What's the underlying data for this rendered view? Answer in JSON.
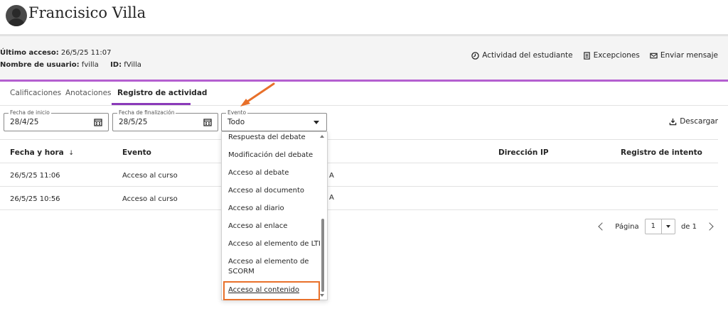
{
  "user": {
    "name": "Francisico Villa"
  },
  "info": {
    "last_access_label": "Último acceso:",
    "last_access_value": "26/5/25 11:07",
    "username_label": "Nombre de usuario:",
    "username_value": "fvilla",
    "id_label": "ID:",
    "id_value": "fVilla"
  },
  "actions": {
    "student_activity": "Actividad del estudiante",
    "exceptions": "Excepciones",
    "send_message": "Enviar mensaje"
  },
  "tabs": [
    {
      "label": "Calificaciones"
    },
    {
      "label": "Anotaciones"
    },
    {
      "label": "Registro de actividad"
    }
  ],
  "filters": {
    "start_date": {
      "label": "Fecha de inicio",
      "value": "28/4/25"
    },
    "end_date": {
      "label": "Fecha de finalización",
      "value": "28/5/25"
    },
    "event": {
      "label": "Evento",
      "value": "Todo"
    },
    "download": "Descargar"
  },
  "table": {
    "headers": [
      "Fecha y hora",
      "Evento",
      "Dirección IP",
      "Registro de intento"
    ],
    "sort_indicator": "↓",
    "rows": [
      {
        "datetime": "26/5/25 11:06",
        "event": "Acceso al curso",
        "trailing": "A"
      },
      {
        "datetime": "26/5/25 10:56",
        "event": "Acceso al curso",
        "trailing": "A"
      }
    ]
  },
  "pagination": {
    "page_label": "Página",
    "page": "1",
    "of_label": "de 1"
  },
  "dropdown": {
    "options": [
      "Respuesta del debate",
      "Modificación del debate",
      "Acceso al debate",
      "Acceso al documento",
      "Acceso al diario",
      "Acceso al enlace",
      "Acceso al elemento de LTI",
      "Acceso al elemento de",
      "SCORM",
      "Acceso al contenido"
    ],
    "highlighted": "Acceso al contenido"
  },
  "colors": {
    "accent_purple": "#b45fd0",
    "tab_underline": "#8a3ab9",
    "annotation_orange": "#e8702a"
  }
}
